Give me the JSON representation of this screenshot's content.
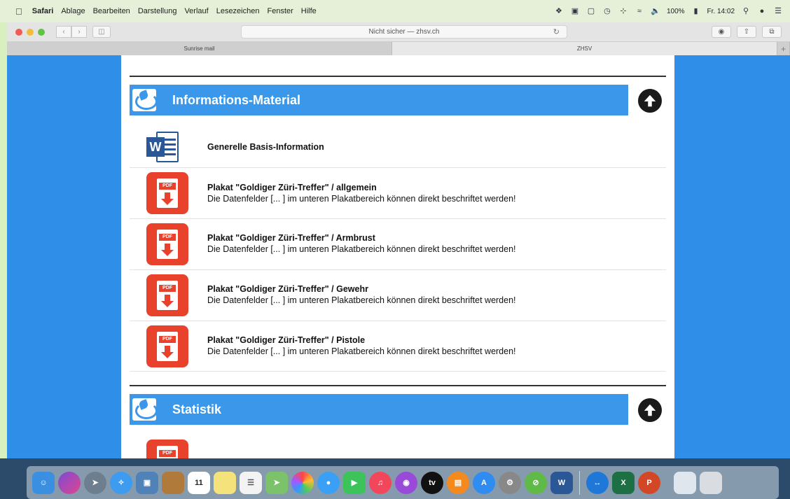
{
  "menubar": {
    "app": "Safari",
    "items": [
      "Ablage",
      "Bearbeiten",
      "Darstellung",
      "Verlauf",
      "Lesezeichen",
      "Fenster",
      "Hilfe"
    ],
    "battery": "100%",
    "clock": "Fr. 14:02"
  },
  "browser": {
    "url": "Nicht sicher — zhsv.ch",
    "tabs": [
      "Sunrise mail",
      "ZHSV"
    ]
  },
  "sections": [
    {
      "title": "Informations-Material",
      "items": [
        {
          "icon": "word",
          "title": "Generelle Basis-Information",
          "desc": ""
        },
        {
          "icon": "pdf",
          "title": "Plakat \"Goldiger Züri-Treffer\" / allgemein",
          "desc": "Die Datenfelder [...  ] im unteren Plakatbereich können direkt beschriftet werden!"
        },
        {
          "icon": "pdf",
          "title": "Plakat \"Goldiger Züri-Treffer\" / Armbrust",
          "desc": "Die Datenfelder [...  ] im unteren Plakatbereich können direkt beschriftet werden!"
        },
        {
          "icon": "pdf",
          "title": "Plakat \"Goldiger Züri-Treffer\" / Gewehr",
          "desc": "Die Datenfelder [...  ] im unteren Plakatbereich können direkt beschriftet werden!"
        },
        {
          "icon": "pdf",
          "title": "Plakat \"Goldiger Züri-Treffer\" / Pistole",
          "desc": "Die Datenfelder [...  ] im unteren Plakatbereich können direkt beschriftet werden!"
        }
      ]
    },
    {
      "title": "Statistik",
      "items": []
    }
  ],
  "pdf_label": "PDF",
  "word_label": "W",
  "colors": {
    "section_bar": "#3a97ea",
    "pdf": "#e8412c",
    "word": "#2b5797",
    "page_bg": "#2f8fe8"
  },
  "dock": {
    "items": [
      "finder-icon",
      "siri-icon",
      "launchpad-icon",
      "safari-icon",
      "preview-icon",
      "notes-app-icon",
      "calendar-icon",
      "stickies-icon",
      "reminders-icon",
      "maps-icon",
      "photos-icon",
      "messages-icon",
      "facetime-icon",
      "music-icon",
      "podcasts-icon",
      "tv-icon",
      "books-icon",
      "app-store-icon",
      "system-preferences-icon",
      "block-icon",
      "word-icon",
      "teamviewer-icon",
      "excel-icon",
      "powerpoint-icon",
      "screenshot-icon",
      "trash-icon"
    ],
    "calendar_day": "11",
    "tv_label": "tv"
  }
}
